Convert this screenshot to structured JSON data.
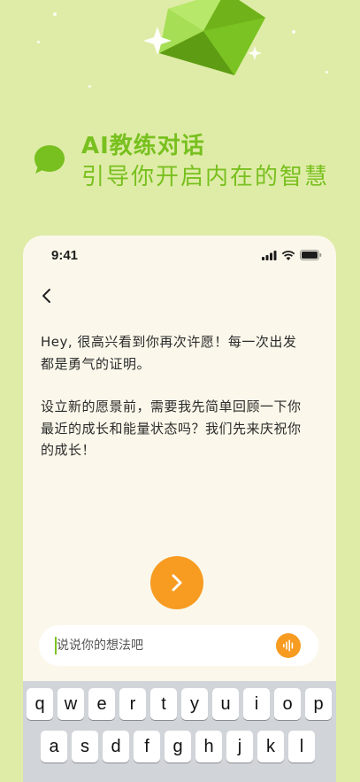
{
  "promo": {
    "title": "AI教练对话",
    "subtitle": "引导你开启内在的智慧",
    "accent_color": "#78c01f"
  },
  "status_bar": {
    "time": "9:41",
    "icons": [
      "signal-icon",
      "wifi-icon",
      "battery-icon"
    ]
  },
  "chat": {
    "back_icon": "chevron-left-icon",
    "message_paragraphs": [
      "Hey, 很高兴看到你再次许愿！每一次出发都是勇气的证明。",
      "设立新的愿景前，需要我先简单回顾一下你最近的成长和能量状态吗？我们先来庆祝你的成长！"
    ],
    "next_icon": "chevron-right-icon",
    "next_color": "#f79b21"
  },
  "composer": {
    "placeholder": "说说你的想法吧",
    "value": "",
    "voice_icon": "voice-wave-icon"
  },
  "keyboard": {
    "row1": [
      "q",
      "w",
      "e",
      "r",
      "t",
      "y",
      "u",
      "i",
      "o",
      "p"
    ],
    "row2": [
      "a",
      "s",
      "d",
      "f",
      "g",
      "h",
      "j",
      "k",
      "l"
    ]
  }
}
